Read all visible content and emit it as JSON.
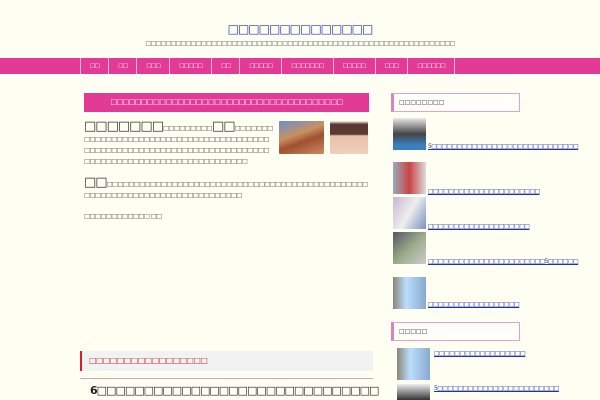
{
  "site": {
    "title": "□□□□□□□□□□□□□□",
    "subtitle": "□□□□□□□□□□□□□□□□□□□□□□□□□□□□□□□□□□□□□□□□□□□□□□□□□□□□□□□□□□□□□"
  },
  "nav": [
    "□□",
    "□□",
    "□□□",
    "□□□□□",
    "□□",
    "□□□□□",
    "□□□□□□□",
    "□□□□□",
    "□□□",
    "□□□□□□"
  ],
  "main": {
    "banner": "□□□□□□□□□□□□□□□□□□□□□□□□□□□□□□□□□□□□□□",
    "p1_big": "□□□□□□□",
    "p1_a": "□□□□□□□□□",
    "p1_big2": "□□",
    "p1_b": "□□□□□□□□□□□□□□□□□□□□□□□□□□□□□□□□□□□□□□□□□□□□□□□□□□□□□□□□□□□□□□□□□□□□□□□□□□□□□□□□□□□□□□□□□□□□□□□□□□□□□□□□□",
    "p2_big": "□□",
    "p2": "□□□□□□□□□□□□□□□□□□□□□□□□□□□□□□□□□□□□□□□□□□□□□□□□□□□□□□□□□□□□□□□□□□□□□□□□□□□□□",
    "p3": "□□□□□□□□□□□□ □□",
    "section_title": "□□□□□□□□□□□□□□□□□",
    "post_title": "6□□□□□□□□□□□□□□□□□□□□□□□□□□□□□□"
  },
  "sidebar": {
    "widget1_title": "□□□□□□□□",
    "widget1_items": [
      "5□□□□□□□□□□□□□□□□□□□□□□□□□□□□□",
      "□□□□□□□□□□□□□□□□□□□□□□",
      "□□□□□□□□□□□□□□□□□□□□",
      "□□□□□□□□□□□□□□□□□□□□□□□5□□□□□□",
      "□□□□□□□□□□□□□□□□□□"
    ],
    "widget2_title": "□□□□□",
    "widget2_items": [
      "□□□□□□□□□□□□□□□□□□",
      "5□□□□□□□□□□□□□□□□□□□□□□□□"
    ]
  },
  "colors": {
    "accent": "#e33a96",
    "bg": "#fffef3",
    "link": "#2233aa"
  }
}
